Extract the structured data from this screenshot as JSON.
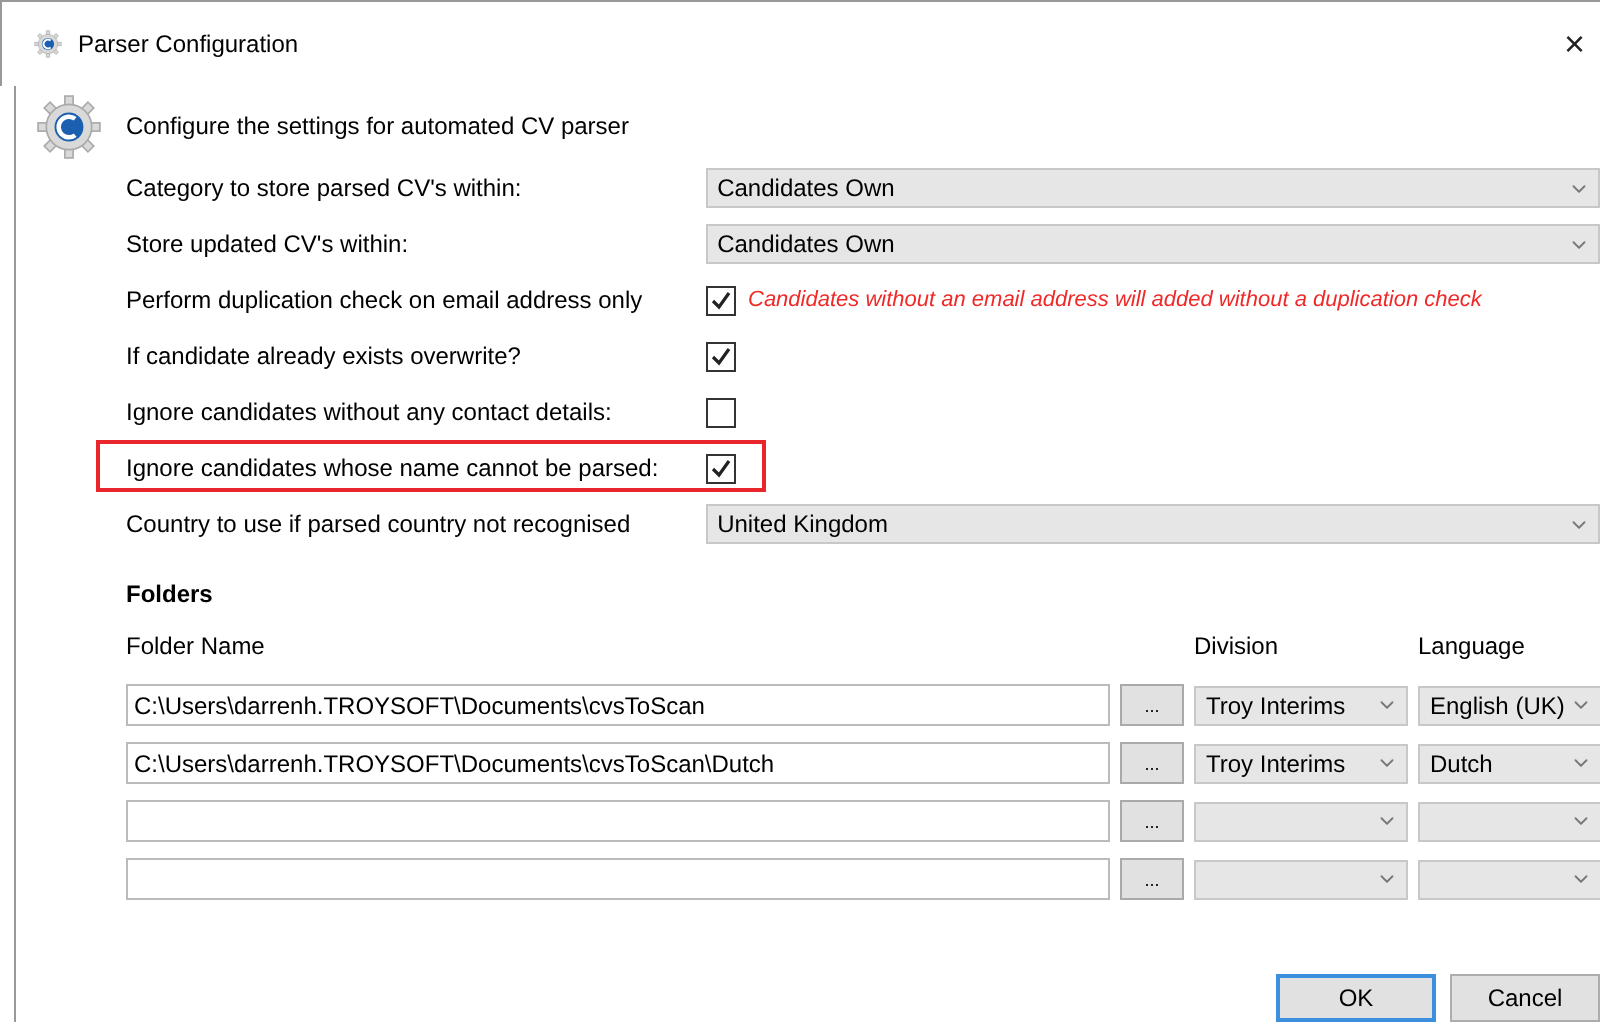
{
  "window": {
    "title": "Parser Configuration",
    "close": "×"
  },
  "header": "Configure the settings for automated CV parser",
  "settings": [
    {
      "kind": "select",
      "label": "Category to store parsed CV's within:",
      "value": "Candidates Own",
      "highlighted": false
    },
    {
      "kind": "select",
      "label": "Store updated CV's within:",
      "value": "Candidates Own",
      "highlighted": false
    },
    {
      "kind": "checkbox",
      "label": "Perform duplication check on email address only",
      "checked": true,
      "note": "Candidates without an email address will added without a duplication check",
      "highlighted": false
    },
    {
      "kind": "checkbox",
      "label": "If candidate already exists overwrite?",
      "checked": true,
      "highlighted": false
    },
    {
      "kind": "checkbox",
      "label": "Ignore candidates without any contact details:",
      "checked": false,
      "highlighted": false
    },
    {
      "kind": "checkbox",
      "label": "Ignore candidates whose name cannot be parsed:",
      "checked": true,
      "highlighted": true
    },
    {
      "kind": "select",
      "label": "Country to use if parsed country not recognised",
      "value": "United Kingdom",
      "highlighted": false
    }
  ],
  "folders": {
    "title": "Folders",
    "columns": [
      "Folder Name",
      "Division",
      "Language"
    ],
    "browse": "...",
    "rows": [
      {
        "path": "C:\\Users\\darrenh.TROYSOFT\\Documents\\cvsToScan",
        "division": "Troy Interims",
        "language": "English (UK)"
      },
      {
        "path": "C:\\Users\\darrenh.TROYSOFT\\Documents\\cvsToScan\\Dutch",
        "division": "Troy Interims",
        "language": "Dutch"
      },
      {
        "path": "",
        "division": "",
        "language": ""
      },
      {
        "path": "",
        "division": "",
        "language": ""
      }
    ]
  },
  "buttons": [
    {
      "label": "OK",
      "default": true
    },
    {
      "label": "Cancel",
      "default": false
    }
  ]
}
